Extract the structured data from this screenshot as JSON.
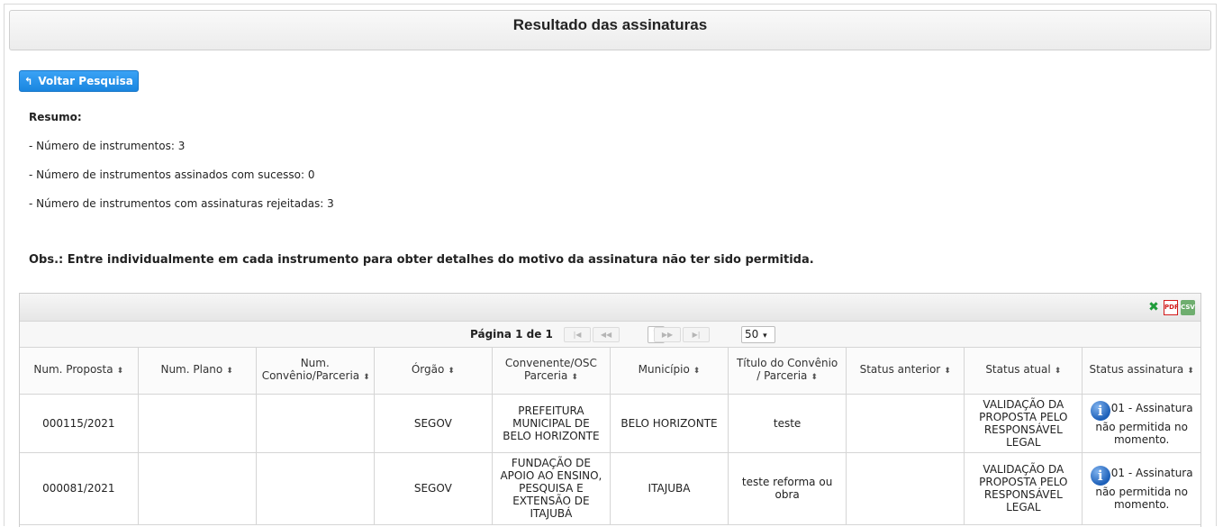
{
  "page": {
    "title": "Resultado das assinaturas",
    "back_button_label": "Voltar Pesquisa"
  },
  "summary": {
    "title": "Resumo:",
    "line1": "- Número de instrumentos: 3",
    "line2": "- Número de instrumentos assinados com sucesso: 0",
    "line3": "- Número de instrumentos com assinaturas rejeitadas: 3",
    "obs": "Obs.: Entre individualmente em cada instrumento para obter detalhes do motivo da assinatura não ter sido permitida."
  },
  "grid": {
    "export_icons": [
      "excel-icon",
      "pdf-icon",
      "csv-icon"
    ],
    "pager": {
      "page_info": "Página 1 de 1",
      "current_page": "1",
      "page_size": "50"
    },
    "columns": [
      "Num. Proposta",
      "Num. Plano",
      "Num. Convênio/Parceria",
      "Órgão",
      "Convenente/OSC Parceria",
      "Município",
      "Título do Convênio / Parceria",
      "Status anterior",
      "Status atual",
      "Status assinatura"
    ],
    "rows": [
      {
        "num_proposta": "000115/2021",
        "num_plano": "",
        "num_convenio": "",
        "orgao": "SEGOV",
        "convenente": "PREFEITURA MUNICIPAL DE BELO HORIZONTE",
        "municipio": "BELO HORIZONTE",
        "titulo": "teste",
        "status_anterior": "",
        "status_atual": "VALIDAÇÃO DA PROPOSTA PELO RESPONSÁVEL LEGAL",
        "status_assinatura": "01 - Assinatura não permitida no momento."
      },
      {
        "num_proposta": "000081/2021",
        "num_plano": "",
        "num_convenio": "",
        "orgao": "SEGOV",
        "convenente": "FUNDAÇÃO DE APOIO AO ENSINO, PESQUISA E EXTENSÃO DE ITAJUBÁ",
        "municipio": "ITAJUBA",
        "titulo": "teste reforma ou obra",
        "status_anterior": "",
        "status_atual": "VALIDAÇÃO DA PROPOSTA PELO RESPONSÁVEL LEGAL",
        "status_assinatura": "01 - Assinatura não permitida no momento."
      }
    ]
  },
  "colors": {
    "button_blue": "#1a86e0",
    "info_icon_blue": "#1c5fb8"
  }
}
